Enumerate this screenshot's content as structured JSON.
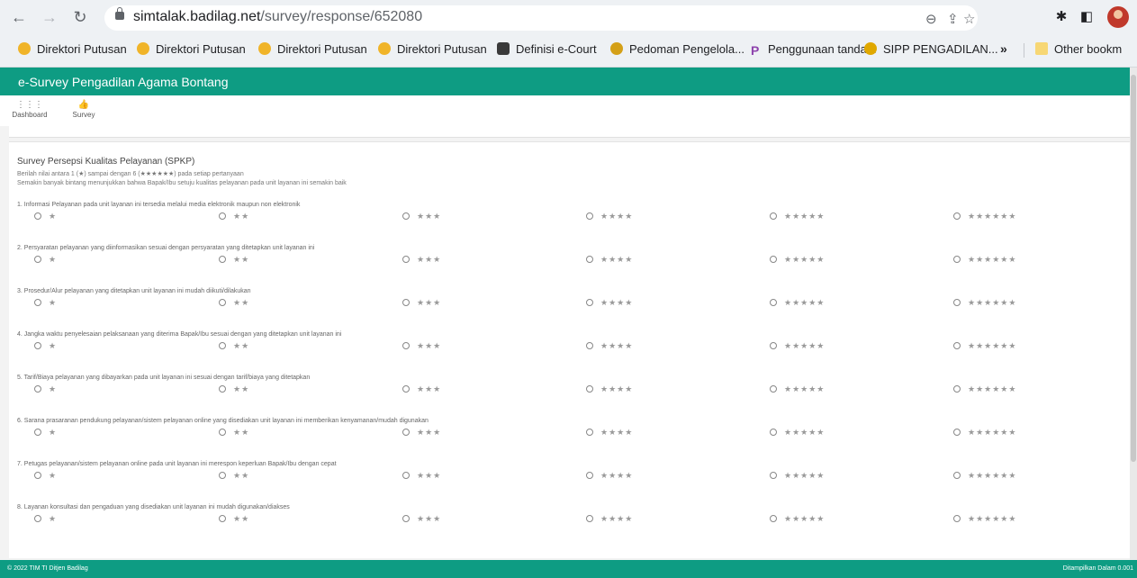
{
  "browser": {
    "url_domain": "simtalak.badilag.net",
    "url_path": "/survey/response/652080",
    "bookmarks": [
      {
        "label": "Direktori Putusan",
        "icon": "mahkamah-agung-icon"
      },
      {
        "label": "Direktori Putusan",
        "icon": "mahkamah-agung-icon"
      },
      {
        "label": "Direktori Putusan",
        "icon": "mahkamah-agung-icon"
      },
      {
        "label": "Direktori Putusan",
        "icon": "mahkamah-agung-icon"
      },
      {
        "label": "Definisi e-Court",
        "icon": "ecourt-icon"
      },
      {
        "label": "Pedoman Pengelola...",
        "icon": "pedoman-icon"
      },
      {
        "label": "Penggunaan tanda...",
        "icon": "p-icon"
      },
      {
        "label": "SIPP PENGADILAN...",
        "icon": "sipp-icon"
      }
    ],
    "more_bookmarks": "»",
    "other_bookmarks": "Other bookm"
  },
  "app": {
    "title": "e-Survey Pengadilan Agama Bontang",
    "menu": [
      {
        "label": "Dashboard",
        "icon": "grid-icon"
      },
      {
        "label": "Survey",
        "icon": "thumbs-up-icon"
      }
    ]
  },
  "survey": {
    "title": "Survey Persepsi Kualitas Pelayanan (SPKP)",
    "instruction1": "Berilah nilai antara 1 (★) sampai dengan 6 (★★★★★★) pada setiap pertanyaan",
    "instruction2": "Semakin banyak bintang menunjukkan bahwa Bapak/Ibu setuju kualitas pelayanan pada unit layanan ini semakin baik",
    "options": [
      "★",
      "★★",
      "★★★",
      "★★★★",
      "★★★★★",
      "★★★★★★"
    ],
    "questions": [
      "1. Informasi Pelayanan pada unit layanan ini tersedia melalui media elektronik maupun non elektronik",
      "2. Persyaratan pelayanan yang diinformasikan sesuai dengan persyaratan yang ditetapkan unit layanan ini",
      "3. Prosedur/Alur pelayanan yang ditetapkan unit layanan ini mudah diikuti/dilakukan",
      "4. Jangka waktu penyelesaian pelaksanaan yang diterima Bapak/Ibu sesuai dengan yang ditetapkan unit layanan ini",
      "5. Tarif/Biaya pelayanan yang dibayarkan pada unit layanan ini sesuai dengan tarif/biaya yang ditetapkan",
      "6. Sarana prasaranan pendukung pelayanan/sistem pelayanan online yang disediakan unit layanan ini memberikan kenyamanan/mudah digunakan",
      "7. Petugas pelayanan/sistem pelayanan online pada unit layanan ini merespon keperluan Bapak/Ibu dengan cepat",
      "8. Layanan konsultasi dan pengaduan yang disediakan unit layanan ini mudah digunakan/diakses"
    ]
  },
  "footer": {
    "left": "© 2022 TIM TI Ditjen Badilag",
    "right": "Ditampilkan Dalam 0.001"
  },
  "colors": {
    "accent": "#0e9c83"
  }
}
